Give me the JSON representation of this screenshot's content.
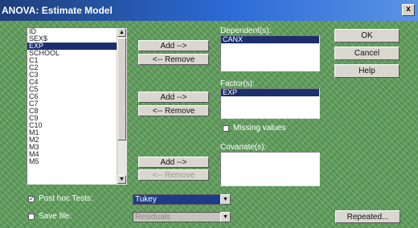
{
  "window": {
    "title": "ANOVA: Estimate Model",
    "close_label": "x"
  },
  "variables": {
    "items": [
      "ID",
      "SEX$",
      "EXP",
      "SCHOOL",
      "C1",
      "C2",
      "C3",
      "C4",
      "C5",
      "C6",
      "C7",
      "C8",
      "C9",
      "C10",
      "M1",
      "M2",
      "M3",
      "M4",
      "M5"
    ],
    "selected": "EXP",
    "scroll_up": "▲",
    "scroll_down": "▼"
  },
  "dependent": {
    "label": "Dependent(s):",
    "items": [
      "CANX"
    ],
    "add_label": "Add -->",
    "remove_label": "<-- Remove"
  },
  "factor": {
    "label": "Factor(s):",
    "items": [
      "EXP"
    ],
    "add_label": "Add -->",
    "remove_label": "<-- Remove",
    "missing_values_label": "Missing values"
  },
  "covariate": {
    "label": "Covariate(s):",
    "items": [],
    "add_label": "Add -->",
    "remove_label": "<-- Remove"
  },
  "buttons": {
    "ok": "OK",
    "cancel": "Cancel",
    "help": "Help",
    "repeated": "Repeated..."
  },
  "options": {
    "post_hoc_label": "Post hoc Tests:",
    "post_hoc_checked": true,
    "post_hoc_value": "Tukey",
    "save_file_label": "Save file:",
    "save_file_checked": false,
    "save_file_value": "Residuals",
    "check_mark": "✓",
    "dropdown_arrow": "▼"
  },
  "colors": {
    "background": "#5f9e5b",
    "selection": "#1c2e6e",
    "title_bar": "#2c6bd6"
  }
}
